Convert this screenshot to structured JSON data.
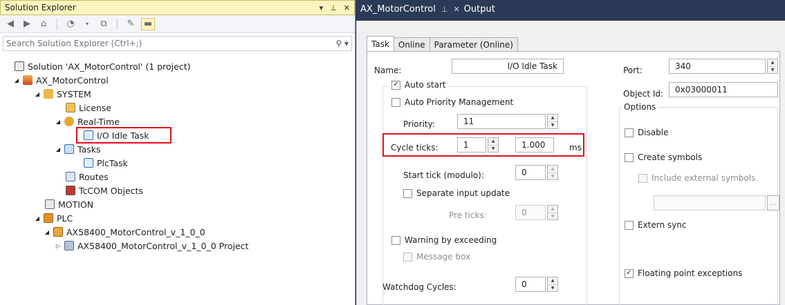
{
  "solution_explorer": {
    "title": "Solution Explorer",
    "title_controls": [
      "▾",
      "⊥",
      "✕"
    ],
    "search_placeholder": "Search Solution Explorer (Ctrl+;)",
    "tree": [
      {
        "label": "Solution 'AX_MotorControl' (1 project)",
        "icon": "solution-icon"
      },
      {
        "label": "AX_MotorControl",
        "icon": "project-icon"
      },
      {
        "label": "SYSTEM",
        "icon": "system-icon"
      },
      {
        "label": "License",
        "icon": "license-icon"
      },
      {
        "label": "Real-Time",
        "icon": "realtime-icon"
      },
      {
        "label": "I/O Idle Task",
        "icon": "task-icon"
      },
      {
        "label": "Tasks",
        "icon": "tasks-icon"
      },
      {
        "label": "PlcTask",
        "icon": "task-icon"
      },
      {
        "label": "Routes",
        "icon": "routes-icon"
      },
      {
        "label": "TcCOM Objects",
        "icon": "tccom-icon"
      },
      {
        "label": "MOTION",
        "icon": "motion-icon"
      },
      {
        "label": "PLC",
        "icon": "plc-icon"
      },
      {
        "label": "AX58400_MotorControl_v_1_0_0",
        "icon": "plc-project-icon"
      },
      {
        "label": "AX58400_MotorControl_v_1_0_0 Project",
        "icon": "plc-project-icon"
      }
    ]
  },
  "document": {
    "tabs": [
      {
        "label": "AX_MotorControl",
        "pin": "⊥",
        "close": "✕"
      },
      {
        "label": "Output"
      }
    ]
  },
  "task_editor": {
    "tabs": [
      "Task",
      "Online",
      "Parameter (Online)"
    ],
    "name_label": "Name:",
    "name_value": "I/O Idle Task",
    "auto_start": {
      "label": "Auto start",
      "checked": true
    },
    "auto_priority": {
      "label": "Auto Priority Management",
      "checked": false
    },
    "priority_label": "Priority:",
    "priority_value": "11",
    "cycle_ticks_label": "Cycle ticks:",
    "cycle_ticks_value": "1",
    "cycle_time_value": "1.000",
    "cycle_unit": "ms",
    "start_tick_label": "Start tick (modulo):",
    "start_tick_value": "0",
    "separate_input": {
      "label": "Separate input update",
      "checked": false
    },
    "pre_ticks_label": "Pre ticks:",
    "pre_ticks_value": "0",
    "warning_exceeding": {
      "label": "Warning by exceeding",
      "checked": false
    },
    "message_box": {
      "label": "Message box",
      "checked": false
    },
    "watchdog_label": "Watchdog Cycles:",
    "watchdog_value": "0",
    "port_label": "Port:",
    "port_value": "340",
    "object_id_label": "Object Id:",
    "object_id_value": "0x03000011",
    "options_title": "Options",
    "disable": {
      "label": "Disable",
      "checked": false
    },
    "create_symbols": {
      "label": "Create symbols",
      "checked": false
    },
    "include_external": {
      "label": "Include external symbols",
      "checked": false
    },
    "extern_sync": {
      "label": "Extern sync",
      "checked": false
    },
    "floating_point": {
      "label": "Floating point exceptions",
      "checked": true
    },
    "ellipsis": "..."
  }
}
